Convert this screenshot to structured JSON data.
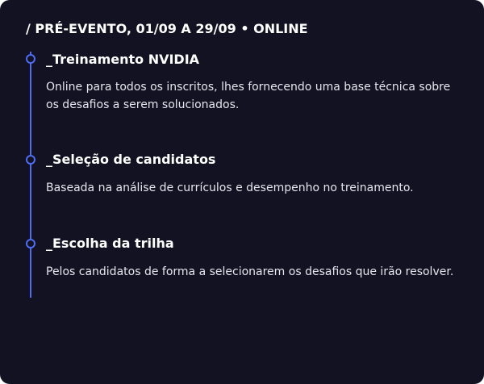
{
  "header": {
    "text": "/ PRÉ-EVENTO, 01/09 A 29/09 • ONLINE"
  },
  "timeline": {
    "items": [
      {
        "title": "_Treinamento NVIDIA",
        "description": "Online para todos os inscritos, lhes fornecendo uma base técnica sobre os desafios a serem solucionados."
      },
      {
        "title": "_Seleção de candidatos",
        "description": "Baseada na análise de currículos e desempenho no treinamento."
      },
      {
        "title": "_Escolha da trilha",
        "description": "Pelos candidatos de forma a selecionarem os desafios que irão resolver."
      }
    ]
  },
  "colors": {
    "background": "#131222",
    "accent": "#4f6cf2",
    "text": "#ffffff"
  },
  "icons": {
    "timeline_marker": "circle-outline-icon"
  }
}
